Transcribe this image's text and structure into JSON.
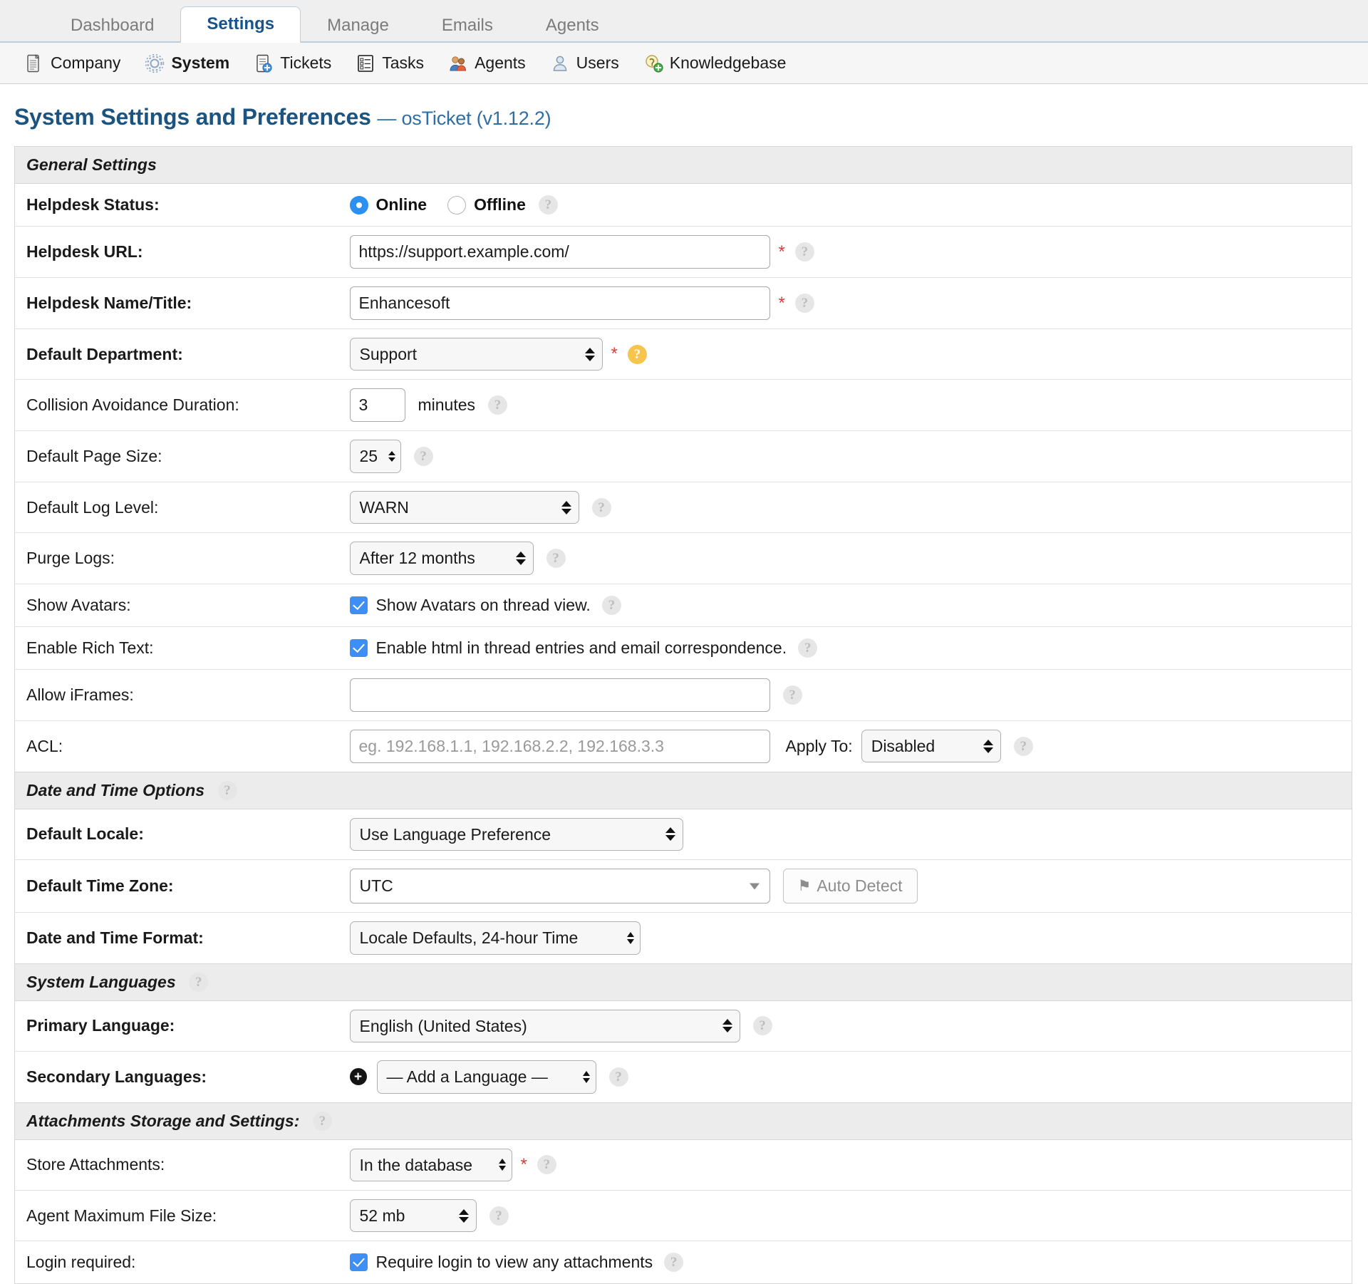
{
  "tabs": [
    {
      "label": "Dashboard",
      "active": false
    },
    {
      "label": "Settings",
      "active": true
    },
    {
      "label": "Manage",
      "active": false
    },
    {
      "label": "Emails",
      "active": false
    },
    {
      "label": "Agents",
      "active": false
    }
  ],
  "subnav": [
    {
      "label": "Company",
      "icon": "company-document-icon",
      "current": false
    },
    {
      "label": "System",
      "icon": "system-gear-icon",
      "current": true
    },
    {
      "label": "Tickets",
      "icon": "tickets-page-icon",
      "current": false
    },
    {
      "label": "Tasks",
      "icon": "tasks-list-icon",
      "current": false
    },
    {
      "label": "Agents",
      "icon": "agents-people-icon",
      "current": false
    },
    {
      "label": "Users",
      "icon": "users-person-icon",
      "current": false
    },
    {
      "label": "Knowledgebase",
      "icon": "knowledgebase-bulb-icon",
      "current": false
    }
  ],
  "page": {
    "title": "System Settings and Preferences",
    "subtitle": "— osTicket (v1.12.2)"
  },
  "sections": {
    "general": {
      "heading": "General Settings",
      "helpdesk_status": {
        "label": "Helpdesk Status:",
        "online_label": "Online",
        "offline_label": "Offline",
        "selected": "Online"
      },
      "helpdesk_url": {
        "label": "Helpdesk URL:",
        "value": "https://support.example.com/",
        "required": "*"
      },
      "helpdesk_name": {
        "label": "Helpdesk Name/Title:",
        "value": "Enhancesoft",
        "required": "*"
      },
      "default_department": {
        "label": "Default Department:",
        "value": "Support",
        "required": "*"
      },
      "collision": {
        "label": "Collision Avoidance Duration:",
        "value": "3",
        "unit": "minutes"
      },
      "page_size": {
        "label": "Default Page Size:",
        "value": "25"
      },
      "log_level": {
        "label": "Default Log Level:",
        "value": "WARN"
      },
      "purge_logs": {
        "label": "Purge Logs:",
        "value": "After 12 months"
      },
      "show_avatars": {
        "label": "Show Avatars:",
        "checkbox_label": "Show Avatars on thread view.",
        "checked": true
      },
      "rich_text": {
        "label": "Enable Rich Text:",
        "checkbox_label": "Enable html in thread entries and email correspondence.",
        "checked": true
      },
      "allow_iframes": {
        "label": "Allow iFrames:",
        "value": ""
      },
      "acl": {
        "label": "ACL:",
        "placeholder": "eg. 192.168.1.1, 192.168.2.2, 192.168.3.3",
        "value": "",
        "apply_to_label": "Apply To:",
        "apply_to_value": "Disabled"
      }
    },
    "datetime": {
      "heading": "Date and Time Options",
      "default_locale": {
        "label": "Default Locale:",
        "value": "Use Language Preference"
      },
      "default_timezone": {
        "label": "Default Time Zone:",
        "value": "UTC",
        "auto_detect_label": "Auto Detect"
      },
      "datetime_format": {
        "label": "Date and Time Format:",
        "value": "Locale Defaults, 24-hour Time"
      }
    },
    "languages": {
      "heading": "System Languages",
      "primary": {
        "label": "Primary Language:",
        "value": "English (United States)"
      },
      "secondary": {
        "label": "Secondary Languages:",
        "value": "— Add a Language —"
      }
    },
    "attachments": {
      "heading": "Attachments Storage and Settings:",
      "store": {
        "label": "Store Attachments:",
        "value": "In the database",
        "required": "*"
      },
      "max_size": {
        "label": "Agent Maximum File Size:",
        "value": "52 mb"
      },
      "login_required": {
        "label": "Login required:",
        "checkbox_label": "Require login to view any attachments",
        "checked": true
      }
    }
  },
  "icons": {
    "help": "?",
    "plus": "+",
    "pin": "⚑"
  },
  "colors": {
    "accent": "#1b5480",
    "active_tab_text": "#18548a",
    "checkbox": "#3d8ef5",
    "radio": "#2c8ff2",
    "required": "#e03c3c",
    "help_highlight": "#f7c54d"
  }
}
